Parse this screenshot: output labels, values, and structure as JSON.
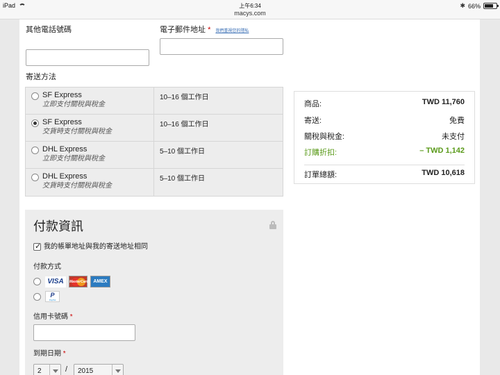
{
  "status_bar": {
    "device": "iPad",
    "time": "上午6:34",
    "url": "macys.com",
    "battery": "66%"
  },
  "contact": {
    "other_phone_label": "其他電話號碼",
    "other_phone_value": "",
    "email_label": "電子郵件地址",
    "email_required": "*",
    "privacy_link": "我們重視您的隱私",
    "email_value": ""
  },
  "shipping": {
    "label": "寄送方法",
    "options": [
      {
        "name": "SF Express",
        "sub": "立即支付關稅與稅金",
        "time": "10–16 個工作日",
        "selected": false
      },
      {
        "name": "SF Express",
        "sub": "交貨時支付關稅與稅金",
        "time": "10–16 個工作日",
        "selected": true
      },
      {
        "name": "DHL Express",
        "sub": "立即支付關稅與稅金",
        "time": "5–10 個工作日",
        "selected": false
      },
      {
        "name": "DHL Express",
        "sub": "交貨時支付關稅與稅金",
        "time": "5–10 個工作日",
        "selected": false
      }
    ]
  },
  "summary": {
    "items_label": "商品:",
    "items_value": "TWD 11,760",
    "shipping_label": "寄送:",
    "shipping_value": "免費",
    "duties_label": "關稅與稅金:",
    "duties_value": "未支付",
    "discount_label": "訂購折扣:",
    "discount_value": "– TWD 1,142",
    "total_label": "訂單總額:",
    "total_value": "TWD 10,618",
    "discount_color": "#5a9a1a"
  },
  "payment": {
    "title": "付款資訊",
    "same_address_label": "我的帳單地址與我的寄送地址相同",
    "same_address_checked": true,
    "method_label": "付款方式",
    "card_icons": [
      "visa-icon",
      "mastercard-icon",
      "amex-icon"
    ],
    "visa_text": "VISA",
    "mastercard_text": "MasterCard",
    "amex_text": "AMEX",
    "paypal_text": "P",
    "paypal_small": "PayPal",
    "card_number_label": "信用卡號碼",
    "card_number_required": "*",
    "card_number_value": "",
    "expiry_label": "到期日期",
    "expiry_required": "*",
    "expiry_month": "2",
    "expiry_separator": "/",
    "expiry_year": "2015"
  }
}
